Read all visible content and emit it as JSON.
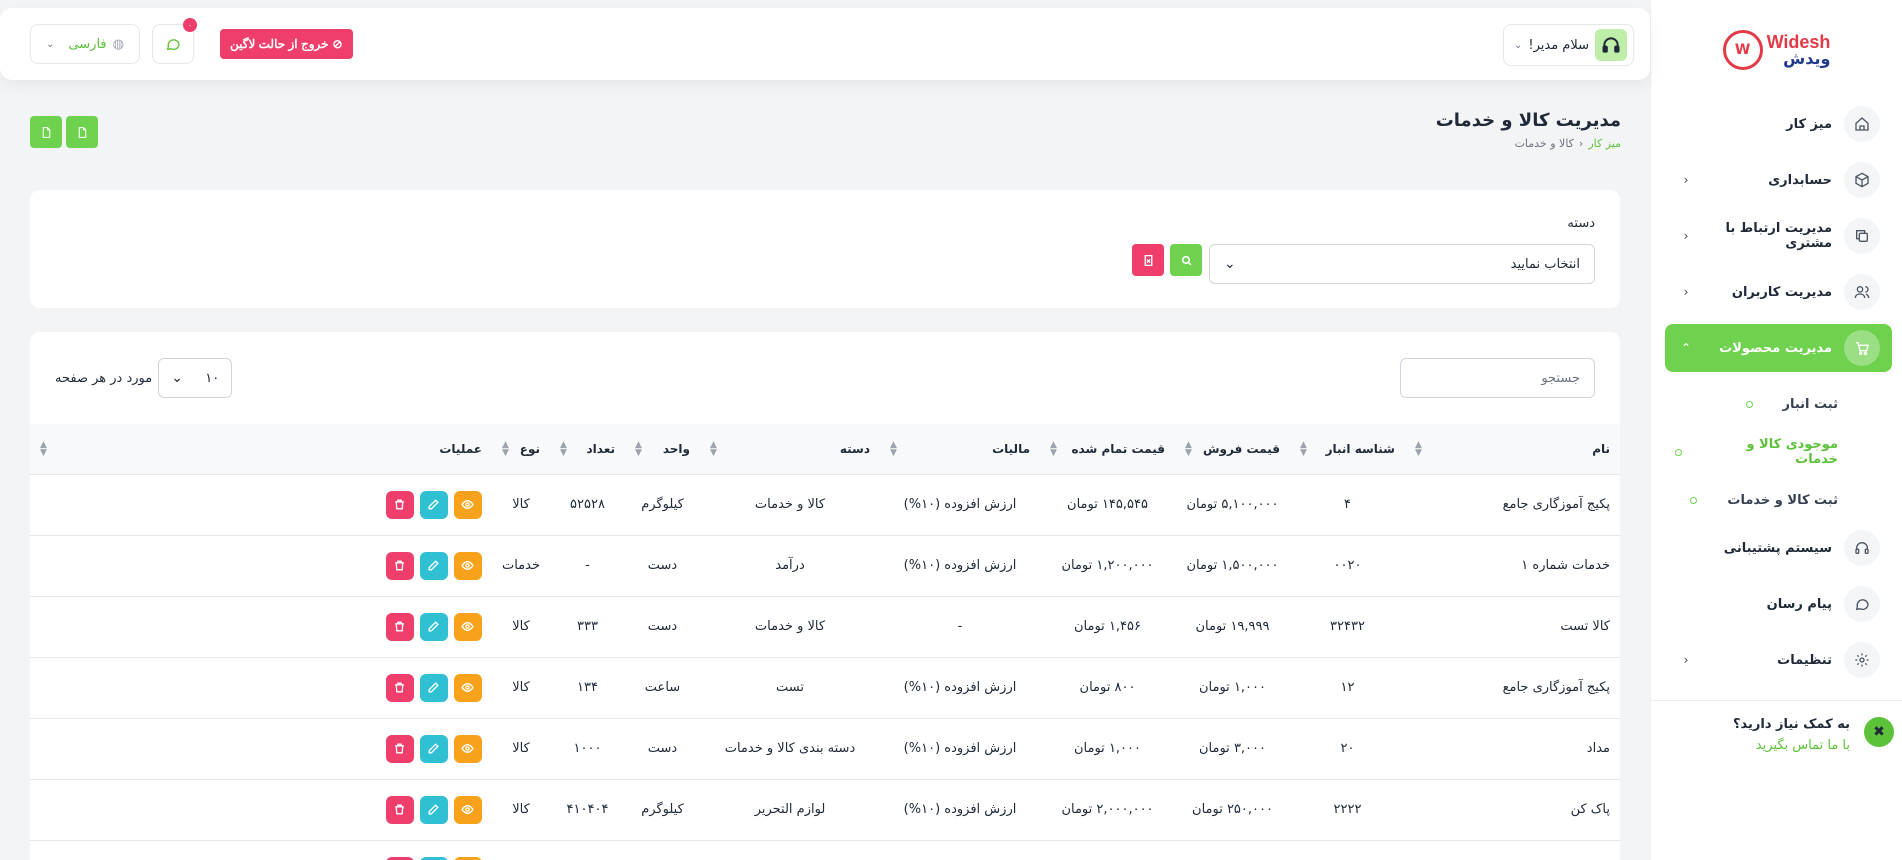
{
  "logo": {
    "en": "Widesh",
    "fa": "ویدش"
  },
  "sidebar": {
    "items": [
      {
        "label": "میز کار",
        "icon": "home-icon",
        "chevron": false
      },
      {
        "label": "حسابداری",
        "icon": "box-icon",
        "chevron": true
      },
      {
        "label": "مدیریت ارتباط با مشتری",
        "icon": "copy-icon",
        "chevron": true
      },
      {
        "label": "مدیریت کاربران",
        "icon": "users-icon",
        "chevron": true
      },
      {
        "label": "مدیریت محصولات",
        "icon": "cart-icon",
        "chevron": true,
        "active": true
      }
    ],
    "sub_items": [
      {
        "label": "ثبت انبار"
      },
      {
        "label": "موجودی کالا و خدمات",
        "active": true
      },
      {
        "label": "ثبت کالا و خدمات"
      }
    ],
    "items_after": [
      {
        "label": "سیستم پشتیبانی",
        "icon": "headset-icon",
        "chevron": false
      },
      {
        "label": "پیام رسان",
        "icon": "message-icon",
        "chevron": false
      },
      {
        "label": "تنظیمات",
        "icon": "gear-icon",
        "chevron": true
      }
    ],
    "help": {
      "title": "به کمک نیاز دارید؟",
      "link": "با ما تماس بگیرید"
    }
  },
  "topbar": {
    "user_greeting": "سلام مدیر!",
    "logout_label": "خروج از حالت لاگین",
    "chat_badge": "۰",
    "language": "فارسی"
  },
  "page": {
    "title": "مدیریت کالا و خدمات",
    "breadcrumb_home": "میز کار",
    "breadcrumb_current": "کالا و خدمات"
  },
  "filter": {
    "category_label": "دسته",
    "category_value": "انتخاب نمایید"
  },
  "table": {
    "search_placeholder": "جستجو",
    "per_page_value": "۱۰",
    "per_page_label": "مورد در هر صفحه",
    "columns": [
      "نام",
      "شناسه انبار",
      "قیمت فروش",
      "قیمت تمام شده",
      "مالیات",
      "دسته",
      "واحد",
      "تعداد",
      "نوع",
      "عملیات"
    ],
    "rows": [
      [
        "پکیج آموزگاری جامع",
        "۴",
        "۵,۱۰۰,۰۰۰ تومان",
        "۱۴۵,۵۴۵ تومان",
        "ارزش افزوده (۱۰%)",
        "کالا و خدمات",
        "کیلوگرم",
        "۵۲۵۲۸",
        "کالا"
      ],
      [
        "خدمات شماره ۱",
        "۰۰۲۰",
        "۱,۵۰۰,۰۰۰ تومان",
        "۱,۲۰۰,۰۰۰ تومان",
        "ارزش افزوده (۱۰%)",
        "درآمد",
        "دست",
        "-",
        "خدمات"
      ],
      [
        "کالا تست",
        "۳۲۴۳۲",
        "۱۹,۹۹۹ تومان",
        "۱,۴۵۶ تومان",
        "-",
        "کالا و خدمات",
        "دست",
        "۳۳۳",
        "کالا"
      ],
      [
        "پکیج آموزگاری جامع",
        "۱۲",
        "۱,۰۰۰ تومان",
        "۸۰۰ تومان",
        "ارزش افزوده (۱۰%)",
        "تست",
        "ساعت",
        "۱۳۴",
        "کالا"
      ],
      [
        "مداد",
        "۲۰",
        "۳,۰۰۰ تومان",
        "۱,۰۰۰ تومان",
        "ارزش افزوده (۱۰%)",
        "دسته بندی کالا و خدمات",
        "دست",
        "۱۰۰۰",
        "کالا"
      ],
      [
        "پاک کن",
        "۲۲۲۲",
        "۲۵۰,۰۰۰ تومان",
        "۲,۰۰۰,۰۰۰ تومان",
        "ارزش افزوده (۱۰%)",
        "لوازم التحریر",
        "کیلوگرم",
        "۴۱۰۴۰۴",
        "کالا"
      ],
      [
        "",
        "",
        "",
        "",
        "",
        "",
        "",
        "",
        ""
      ]
    ]
  },
  "colors": {
    "accent": "#6fd24e",
    "danger": "#ef3e6b",
    "warning": "#f8a21b",
    "info": "#2fc0d4"
  }
}
